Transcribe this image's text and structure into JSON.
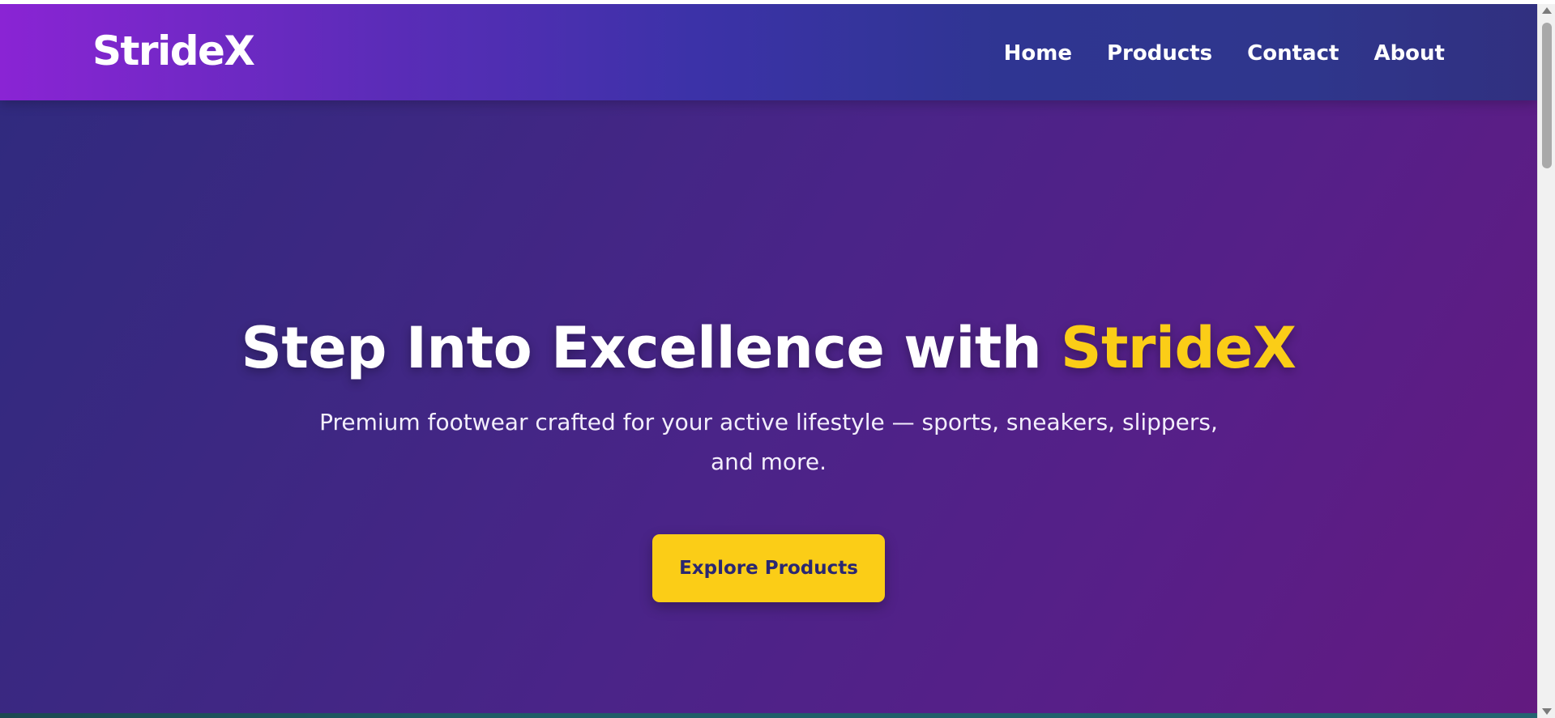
{
  "navbar": {
    "logo": "StrideX",
    "links": [
      {
        "label": "Home"
      },
      {
        "label": "Products"
      },
      {
        "label": "Contact"
      },
      {
        "label": "About"
      }
    ]
  },
  "hero": {
    "title_main": "Step Into Excellence with ",
    "title_accent": "StrideX",
    "subtitle": "Premium footwear crafted for your active lifestyle — sports, sneakers, slippers, and more.",
    "cta_label": "Explore Products"
  },
  "colors": {
    "accent": "#fbcd17",
    "button_text": "#2a2772",
    "nav_gradient_start": "#8a24d4",
    "nav_gradient_end": "#313080",
    "hero_gradient_start": "#2f2a7e",
    "hero_gradient_end": "#631a80"
  },
  "icons": {
    "scroll_up": "triangle-up-icon",
    "scroll_down": "triangle-down-icon"
  }
}
